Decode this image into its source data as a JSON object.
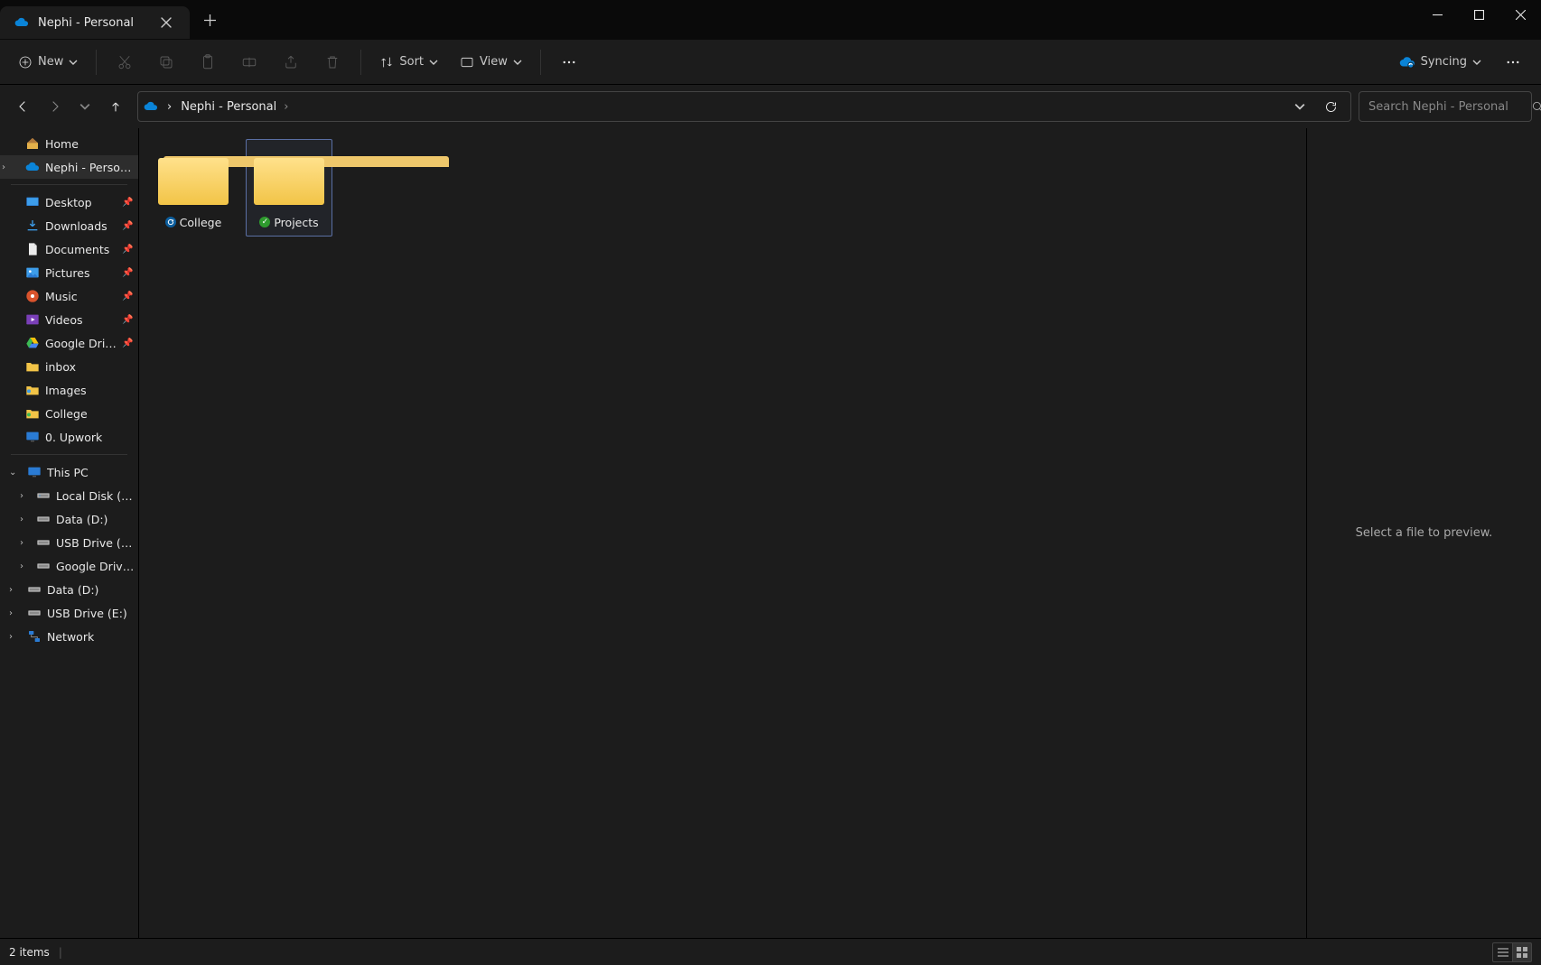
{
  "window": {
    "tab_title": "Nephi - Personal"
  },
  "toolbar": {
    "new_label": "New",
    "sort_label": "Sort",
    "view_label": "View",
    "sync_label": "Syncing"
  },
  "address": {
    "location": "Nephi - Personal",
    "search_placeholder": "Search Nephi - Personal"
  },
  "sidebar": {
    "home": "Home",
    "nephi": "Nephi - Personal",
    "desktop": "Desktop",
    "downloads": "Downloads",
    "documents": "Documents",
    "pictures": "Pictures",
    "music": "Music",
    "videos": "Videos",
    "gdrive": "Google Drive",
    "inbox": "inbox",
    "images": "Images",
    "college": "College",
    "upwork": "0. Upwork",
    "this_pc": "This PC",
    "local_c": "Local Disk (C:)",
    "data_d": "Data (D:)",
    "usb_e": "USB Drive (E:)",
    "gdrive_g": "Google Drive (G:)",
    "data_dx": "Data (D:)",
    "usb_ex": "USB Drive (E:)",
    "network": "Network"
  },
  "files": {
    "items": [
      {
        "name": "College",
        "status": "sync"
      },
      {
        "name": "Projects",
        "status": "ok"
      }
    ]
  },
  "preview": {
    "empty_text": "Select a file to preview."
  },
  "status": {
    "count": "2 items"
  }
}
